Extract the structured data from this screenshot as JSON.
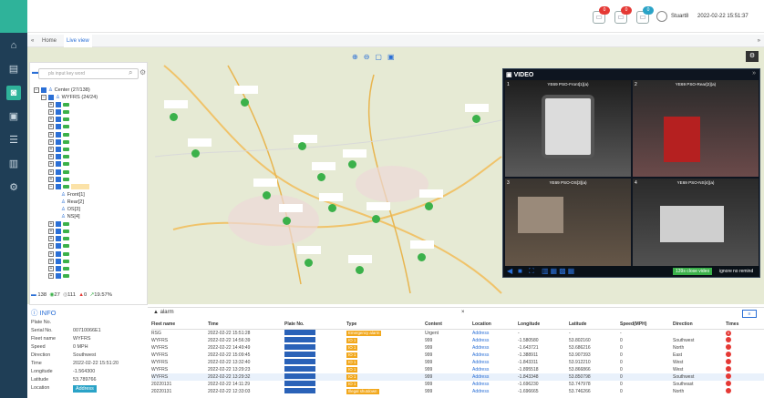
{
  "topbar": {
    "badges": [
      "0",
      "0",
      "0"
    ],
    "user": "Stuart8",
    "datetime": "2022-02-22 15:51:37"
  },
  "tabs": [
    "Home",
    "Live view"
  ],
  "search": {
    "placeholder": "pls input key word"
  },
  "tree": {
    "root": "Center (27/138)",
    "group": "WYFRS (24/24)",
    "channels": [
      "Front[1]",
      "Rear[2]",
      "OS[3]",
      "NS[4]"
    ]
  },
  "stats": {
    "total": "138",
    "online": "27",
    "offline": "111",
    "alarm": "0",
    "rate": "19.57%"
  },
  "info": {
    "title": "INFO",
    "rows": [
      {
        "k": "Plate No.",
        "v": ""
      },
      {
        "k": "Serial No.",
        "v": "00710066E1"
      },
      {
        "k": "Fleet name",
        "v": "WYFRS"
      },
      {
        "k": "Speed",
        "v": "0 MPH"
      },
      {
        "k": "Direction",
        "v": "Southwest"
      },
      {
        "k": "Time",
        "v": "2022-02-22 15:51:20"
      },
      {
        "k": "Longitude",
        "v": "-1.564300"
      },
      {
        "k": "Latitude",
        "v": "53.789766"
      },
      {
        "k": "Location",
        "v": "Address"
      }
    ]
  },
  "video": {
    "title": "VIDEO",
    "cells": [
      {
        "n": "1",
        "label": "YE69 PSO-Front[1](a)"
      },
      {
        "n": "2",
        "label": "YE69 PSO-Rear[2](a)"
      },
      {
        "n": "3",
        "label": "YE69 PSO-OS[3](a)"
      },
      {
        "n": "4",
        "label": "YE69 PSO-NS[4](a)"
      }
    ],
    "close_text": "139s close video",
    "ignore_text": "ignore",
    "no_remind": "no remind"
  },
  "alarm": {
    "tab": "alarm",
    "headers": [
      "Fleet name",
      "Time",
      "Plate No.",
      "Type",
      "Content",
      "Location",
      "Longitude",
      "Latitude",
      "Speed(MPH)",
      "Direction",
      "Times"
    ],
    "rows": [
      [
        "RSG",
        "2022-02-22 15:51:28",
        "Emergency alarm",
        "Urgent",
        "Address",
        "-",
        "-",
        "-",
        "",
        "0"
      ],
      [
        "WYFRS",
        "2022-02-22 14:56:39",
        "IO 1",
        "999",
        "Address",
        "-1.580580",
        "53.802160",
        "0",
        "Southwest",
        ""
      ],
      [
        "WYFRS",
        "2022-02-22 14:49:49",
        "IO 1",
        "999",
        "Address",
        "-1.643721",
        "53.686216",
        "0",
        "North",
        ""
      ],
      [
        "WYFRS",
        "2022-02-22 15:09:45",
        "IO 1",
        "999",
        "Address",
        "-1.388911",
        "53.907393",
        "0",
        "East",
        ""
      ],
      [
        "WYFRS",
        "2022-02-22 13:32:40",
        "IO 1",
        "999",
        "Address",
        "-1.843311",
        "53.912210",
        "0",
        "West",
        ""
      ],
      [
        "WYFRS",
        "2022-02-22 13:29:23",
        "IO 1",
        "999",
        "Address",
        "-1.895518",
        "53.866866",
        "0",
        "West",
        ""
      ],
      [
        "WYFRS",
        "2022-02-22 13:29:32",
        "IO 1",
        "999",
        "Address",
        "-1.843348",
        "53.850798",
        "0",
        "Southwest",
        ""
      ],
      [
        "20220131",
        "2022-02-22 14:11:29",
        "IO 1",
        "999",
        "Address",
        "-1.696230",
        "53.747978",
        "0",
        "Southeast",
        ""
      ],
      [
        "20220131",
        "2022-02-22 12:33:03",
        "Illegal shutdown",
        "999",
        "Address",
        "-1.696665",
        "53.746266",
        "0",
        "North",
        ""
      ]
    ]
  }
}
